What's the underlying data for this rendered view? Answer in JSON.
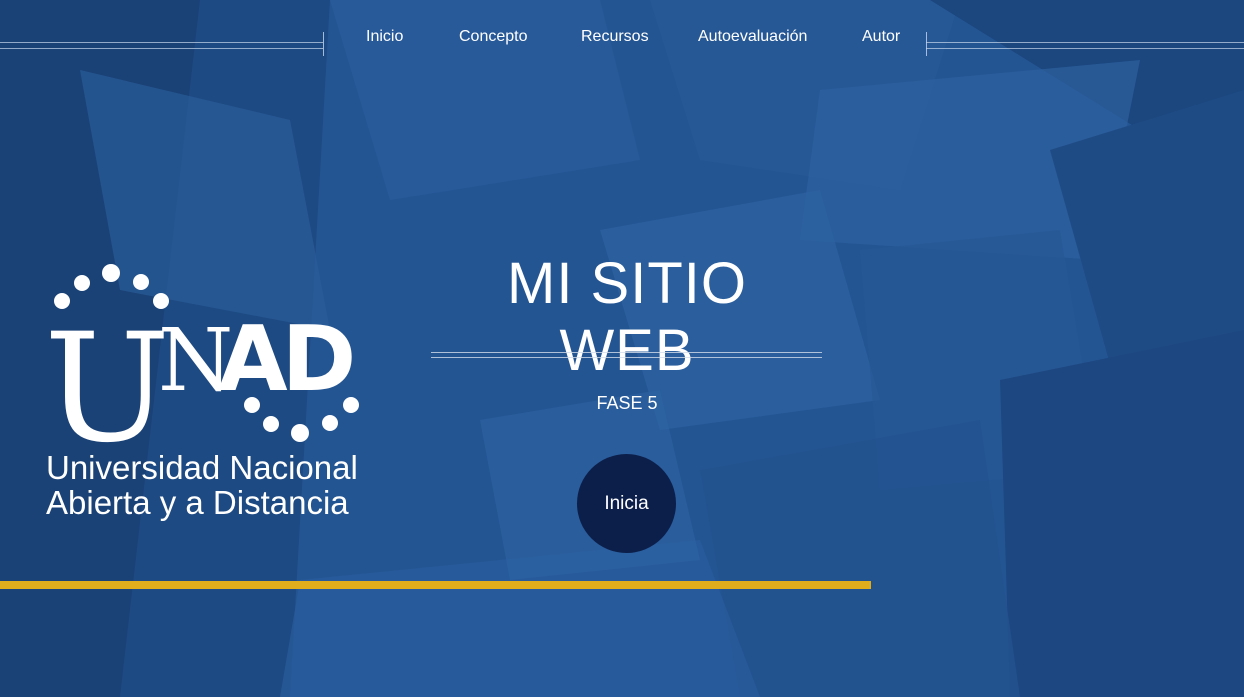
{
  "nav": {
    "items": [
      {
        "label": "Inicio"
      },
      {
        "label": "Concepto"
      },
      {
        "label": "Recursos"
      },
      {
        "label": "Autoevaluación"
      },
      {
        "label": "Autor"
      }
    ]
  },
  "logo": {
    "wordmark": "UNAD",
    "line1": "Universidad Nacional",
    "line2": "Abierta y a Distancia"
  },
  "hero": {
    "title": "MI SITIO WEB",
    "subtitle": "FASE 5",
    "cta_label": "Inicia"
  },
  "colors": {
    "background": "#245593",
    "cta": "#0c1f4a",
    "accent_bar": "#e0ad1c",
    "text": "#ffffff"
  }
}
